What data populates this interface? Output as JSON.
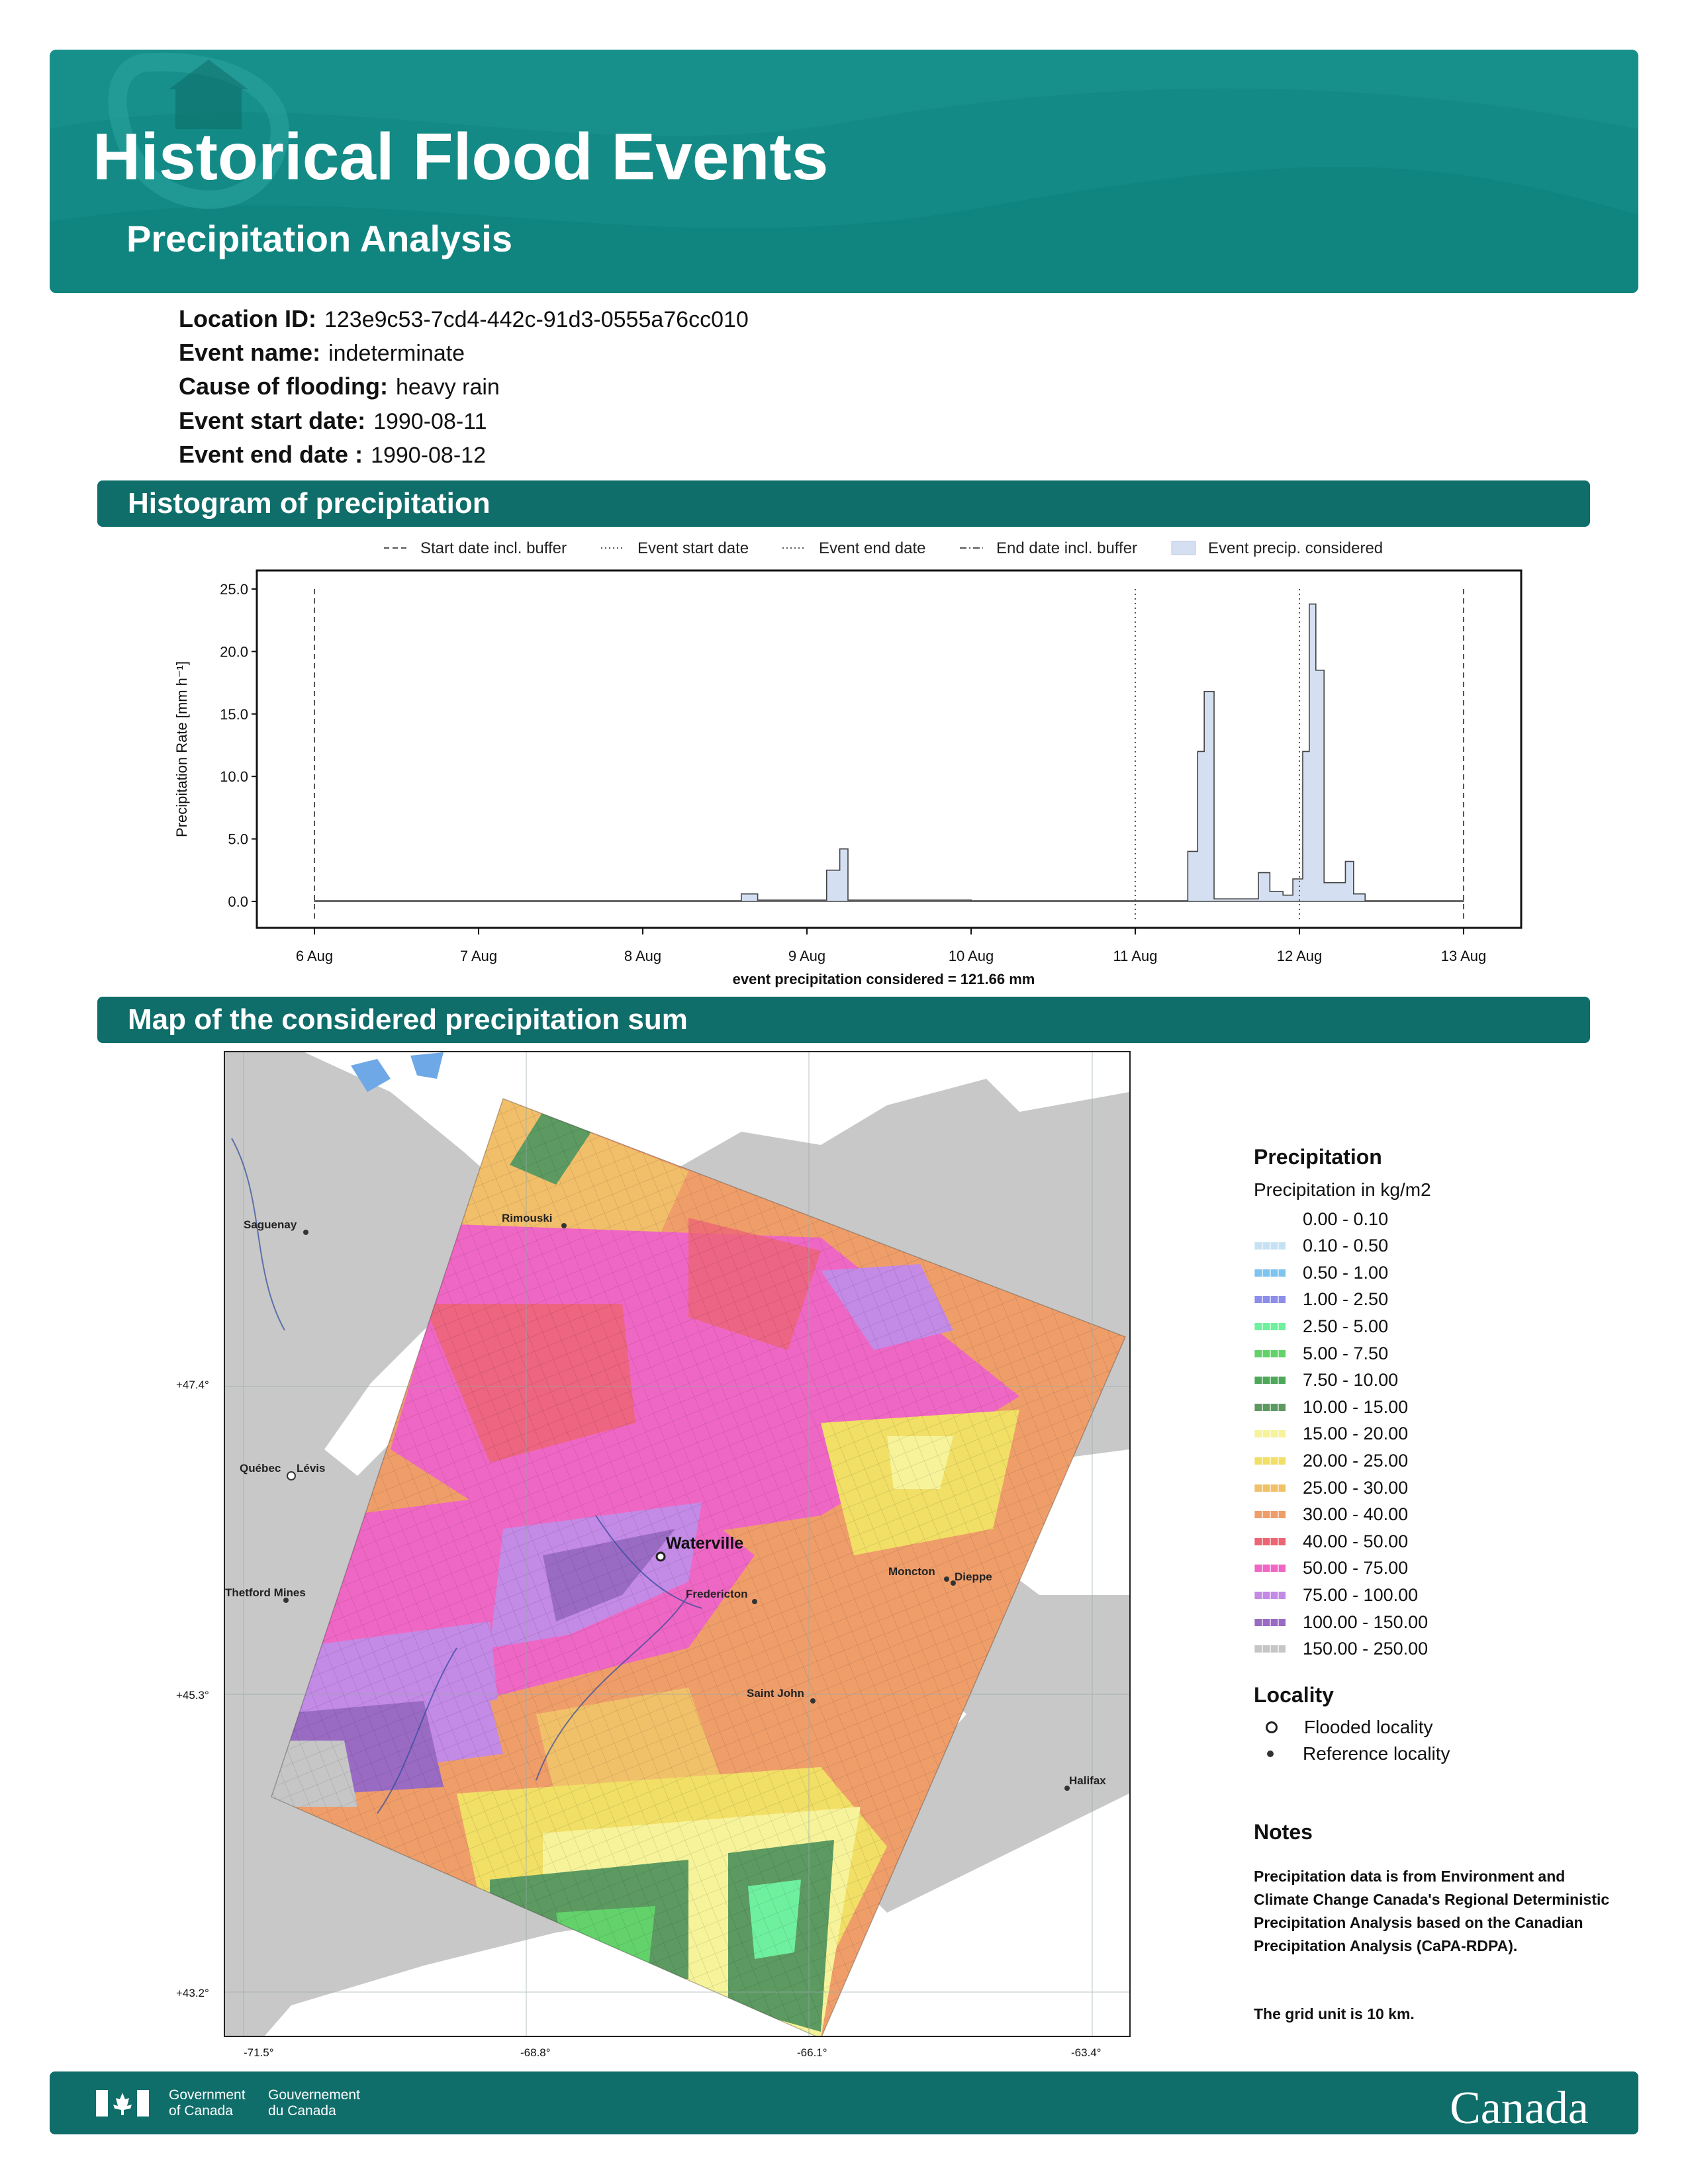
{
  "header": {
    "title": "Historical Flood Events",
    "subtitle": "Precipitation Analysis"
  },
  "event": {
    "location_id_label": "Location ID:",
    "location_id": "123e9c53-7cd4-442c-91d3-0555a76cc010",
    "event_name_label": "Event name:",
    "event_name": "indeterminate",
    "cause_label": "Cause of flooding:",
    "cause": "heavy rain",
    "start_label": "Event start date:",
    "start": "1990-08-11",
    "end_label": "Event end date :",
    "end": "1990-08-12"
  },
  "sections": {
    "histogram": "Histogram of precipitation",
    "map": "Map of the considered precipitation sum"
  },
  "chart_data": {
    "type": "area",
    "ylabel": "Precipitation Rate [mm h⁻¹]",
    "xlabel": "event precipitation considered = 121.66 mm",
    "ylim": [
      0,
      26
    ],
    "y_ticks": [
      "0.0",
      "5.0",
      "10.0",
      "15.0",
      "20.0",
      "25.0"
    ],
    "x_ticks": [
      "6 Aug",
      "7 Aug",
      "8 Aug",
      "9 Aug",
      "10 Aug",
      "11 Aug",
      "12 Aug",
      "13 Aug"
    ],
    "legend": [
      {
        "label": "Start date incl. buffer",
        "style": "dashed"
      },
      {
        "label": "Event start date",
        "style": "dotted"
      },
      {
        "label": "Event end date",
        "style": "dotted"
      },
      {
        "label": "End date incl. buffer",
        "style": "dashdot"
      },
      {
        "label": "Event precip. considered",
        "style": "fill"
      }
    ],
    "vlines_day": [
      0,
      5,
      6,
      7
    ],
    "series": [
      {
        "name": "Event precip. considered",
        "points": [
          [
            0,
            0.05
          ],
          [
            1,
            0.05
          ],
          [
            2,
            0.05
          ],
          [
            2.6,
            0.6
          ],
          [
            2.7,
            0.1
          ],
          [
            3.12,
            2.5
          ],
          [
            3.2,
            4.2
          ],
          [
            3.25,
            0.1
          ],
          [
            4,
            0.05
          ],
          [
            5,
            0.05
          ],
          [
            5.32,
            4.0
          ],
          [
            5.38,
            12.0
          ],
          [
            5.42,
            16.8
          ],
          [
            5.48,
            0.2
          ],
          [
            5.75,
            2.3
          ],
          [
            5.82,
            0.8
          ],
          [
            5.9,
            0.5
          ],
          [
            5.96,
            1.8
          ],
          [
            6.02,
            12.0
          ],
          [
            6.06,
            23.8
          ],
          [
            6.1,
            18.5
          ],
          [
            6.15,
            1.5
          ],
          [
            6.28,
            3.2
          ],
          [
            6.33,
            0.6
          ],
          [
            6.4,
            0.05
          ],
          [
            7,
            0.05
          ]
        ]
      }
    ],
    "color": "#d4dff1",
    "line_color": "#444"
  },
  "map": {
    "lat_labels": [
      "+47.4°",
      "+45.3°",
      "+43.2°"
    ],
    "lon_labels": [
      "-71.5°",
      "-68.8°",
      "-66.1°",
      "-63.4°"
    ],
    "flooded_locality": "Waterville",
    "reference_localities": [
      "Saguenay",
      "Rimouski",
      "Québec",
      "Lévis",
      "Thetford Mines",
      "Fredericton",
      "Moncton",
      "Dieppe",
      "Saint John",
      "Halifax"
    ]
  },
  "legend": {
    "precip_title": "Precipitation",
    "precip_units": "Precipitation in kg/m2",
    "bins": [
      {
        "label": "0.00 - 0.10",
        "color": "#ffffff"
      },
      {
        "label": "0.10 - 0.50",
        "color": "#c4e2f4"
      },
      {
        "label": "0.50 - 1.00",
        "color": "#7fc4ef"
      },
      {
        "label": "1.00 - 2.50",
        "color": "#8d8ee9"
      },
      {
        "label": "2.50 - 5.00",
        "color": "#6ff09f"
      },
      {
        "label": "5.00 - 7.50",
        "color": "#63d26b"
      },
      {
        "label": "7.50 - 10.00",
        "color": "#4ea85a"
      },
      {
        "label": "10.00 - 15.00",
        "color": "#5c9a62"
      },
      {
        "label": "15.00 - 20.00",
        "color": "#f6f39a"
      },
      {
        "label": "20.00 - 25.00",
        "color": "#f1df66"
      },
      {
        "label": "25.00 - 30.00",
        "color": "#f1c16a"
      },
      {
        "label": "30.00 - 40.00",
        "color": "#ef9e6a"
      },
      {
        "label": "40.00 - 50.00",
        "color": "#ec6574"
      },
      {
        "label": "50.00 - 75.00",
        "color": "#ef67c4"
      },
      {
        "label": "75.00 - 100.00",
        "color": "#c38ae6"
      },
      {
        "label": "100.00 - 150.00",
        "color": "#9a6bc3"
      },
      {
        "label": "150.00 - 250.00",
        "color": "#c6c6c6"
      }
    ],
    "locality_title": "Locality",
    "flooded_label": "Flooded locality",
    "reference_label": "Reference locality"
  },
  "notes": {
    "title": "Notes",
    "text1": "Precipitation data is from Environment and Climate Change Canada's Regional Deterministic Precipitation Analysis based on the Canadian Precipitation Analysis (CaPA-RDPA).",
    "text2": "The grid unit is 10 km."
  },
  "footer": {
    "gov_en": "Government of Canada",
    "gov_en_1": "Government",
    "gov_en_2": "of Canada",
    "gov_fr_1": "Gouvernement",
    "gov_fr_2": "du Canada",
    "wordmark": "Canada"
  }
}
